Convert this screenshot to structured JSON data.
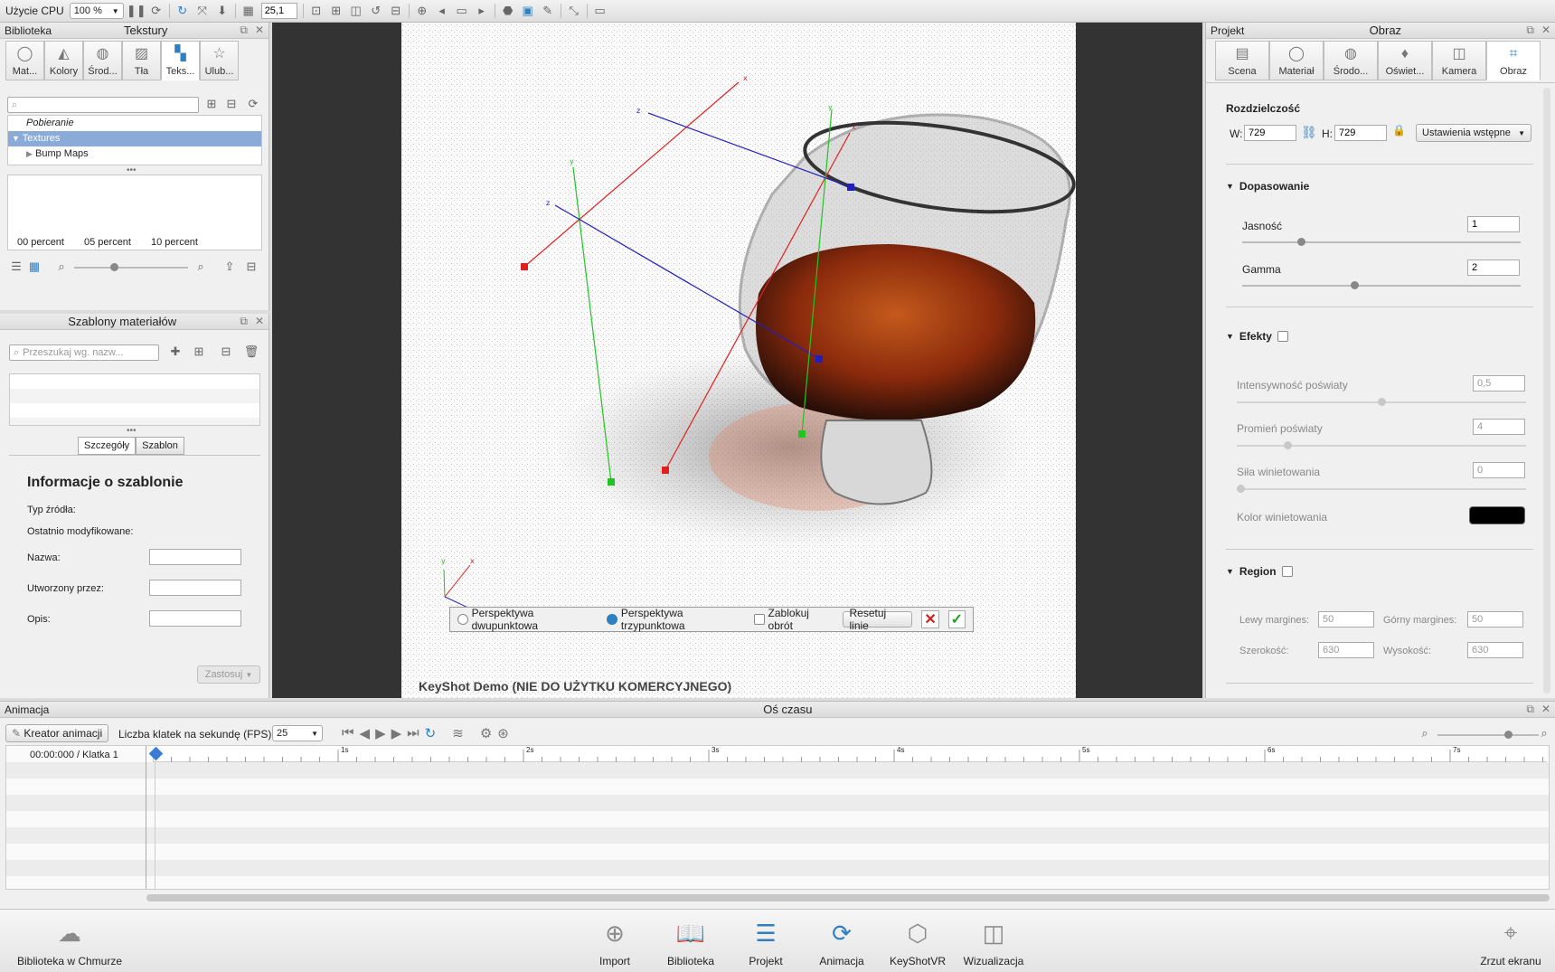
{
  "toolbar": {
    "cpu_label": "Użycie CPU",
    "cpu_value": "100 %",
    "value_field": "25,1"
  },
  "library": {
    "header_left": "Biblioteka",
    "header_title": "Tekstury",
    "tabs": [
      {
        "label": "Mat...",
        "icon": "material-icon"
      },
      {
        "label": "Kolory",
        "icon": "palette-icon"
      },
      {
        "label": "Środ...",
        "icon": "globe-icon"
      },
      {
        "label": "Tła",
        "icon": "image-icon"
      },
      {
        "label": "Teks...",
        "icon": "texture-icon"
      },
      {
        "label": "Ulub...",
        "icon": "star-icon"
      }
    ],
    "tree": [
      "Pobieranie",
      "Textures",
      "Bump Maps"
    ],
    "thumbs": [
      "00 percent",
      "05 percent",
      "10 percent"
    ]
  },
  "templates": {
    "header": "Szablony materiałów",
    "search_placeholder": "Przeszukaj wg. nazw...",
    "tab_details": "Szczegóły",
    "tab_template": "Szablon",
    "info_title": "Informacje o szablonie",
    "source_type": "Typ źródła:",
    "last_modified": "Ostatnio modyfikowane:",
    "name_label": "Nazwa:",
    "created_by": "Utworzony przez:",
    "desc_label": "Opis:",
    "apply": "Zastosuj"
  },
  "viewport": {
    "watermark": "KeyShot Demo (NIE DO UŻYTKU KOMERCYJNEGO)",
    "two_point": "Perspektywa dwupunktowa",
    "three_point": "Perspektywa trzypunktowa",
    "lock_rotation": "Zablokuj obrót",
    "reset_lines": "Resetuj linie"
  },
  "project": {
    "header_left": "Projekt",
    "header_title": "Obraz",
    "tabs": [
      {
        "label": "Scena",
        "icon": "scene-icon"
      },
      {
        "label": "Materiał",
        "icon": "material-icon"
      },
      {
        "label": "Środo...",
        "icon": "environment-icon"
      },
      {
        "label": "Oświet...",
        "icon": "lightbulb-icon"
      },
      {
        "label": "Kamera",
        "icon": "camera-icon"
      },
      {
        "label": "Obraz",
        "icon": "crop-icon"
      }
    ],
    "resolution": "Rozdzielczość",
    "w_label": "W:",
    "w_value": "729",
    "h_label": "H:",
    "h_value": "729",
    "presets": "Ustawienia wstępne",
    "adjust": "Dopasowanie",
    "brightness": "Jasność",
    "brightness_value": "1",
    "gamma": "Gamma",
    "gamma_value": "2",
    "effects": "Efekty",
    "bloom_intensity": "Intensywność poświaty",
    "bloom_intensity_value": "0,5",
    "bloom_radius": "Promień poświaty",
    "bloom_radius_value": "4",
    "vignette_strength": "Siła winietowania",
    "vignette_strength_value": "0",
    "vignette_color": "Kolor winietowania",
    "region": "Region",
    "left_margin": "Lewy margines:",
    "left_margin_value": "50",
    "top_margin": "Górny margines:",
    "top_margin_value": "50",
    "width": "Szerokość:",
    "width_value": "630",
    "height": "Wysokość:",
    "height_value": "630"
  },
  "animation": {
    "header_left": "Animacja",
    "header_title": "Oś czasu",
    "creator": "Kreator animacji",
    "fps_label": "Liczba klatek na sekundę (FPS):",
    "fps_value": "25",
    "time_label": "00:00:000 / Klatka 1",
    "ticks": [
      "1s",
      "2s",
      "3s",
      "4s",
      "5s",
      "6s",
      "7s"
    ]
  },
  "dock": {
    "cloud": "Biblioteka w Chmurze",
    "import": "Import",
    "library": "Biblioteka",
    "project": "Projekt",
    "animation": "Animacja",
    "keyshotvr": "KeyShotVR",
    "render": "Wizualizacja",
    "screenshot": "Zrzut ekranu"
  }
}
